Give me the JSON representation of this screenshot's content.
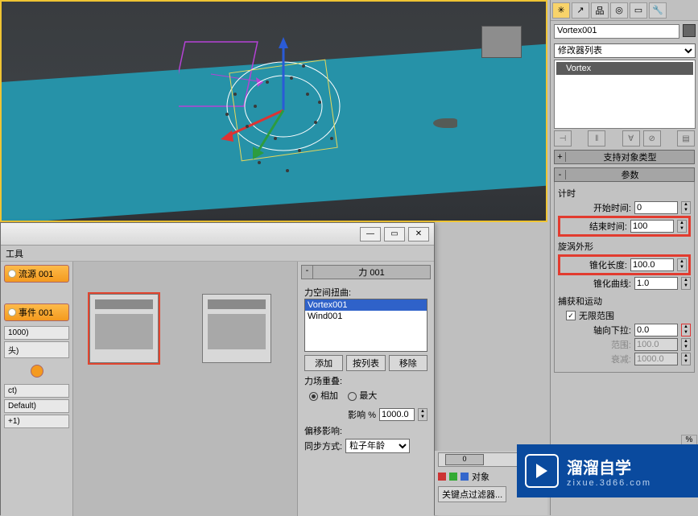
{
  "viewport": {},
  "cmdpanel": {
    "object_name": "Vortex001",
    "modifier_list_label": "修改器列表",
    "stack_item": "Vortex",
    "rollouts": {
      "support_types": {
        "pm": "+",
        "title": "支持对象类型"
      },
      "params": {
        "pm": "-",
        "title": "参数",
        "timing_label": "计时",
        "start_label": "开始时间:",
        "start_val": "0",
        "end_label": "结束时间:",
        "end_val": "100",
        "vortex_shape_label": "旋涡外形",
        "taper_len_label": "锥化长度:",
        "taper_len_val": "100.0",
        "taper_curve_label": "锥化曲线:",
        "taper_curve_val": "1.0",
        "capture_label": "捕获和运动",
        "unlimited_label": "无限范围",
        "axial_label": "轴向下拉:",
        "axial_val": "0.0",
        "range_label": "范围:",
        "range_val": "100.0",
        "falloff_label": "衰减:",
        "falloff_val": "1000.0"
      }
    }
  },
  "pview": {
    "menu_tools": "工具",
    "nodes": {
      "pf_source": "流源 001",
      "event": "事件 001",
      "lines": [
        "1000)",
        "头)",
        "ct)",
        "Default)",
        "+1)"
      ]
    },
    "force_panel": {
      "pm": "-",
      "title": "力 001",
      "spacewarps_label": "力空间扭曲:",
      "list": [
        "Vortex001",
        "Wind001"
      ],
      "btn_add": "添加",
      "btn_bylist": "按列表",
      "btn_remove": "移除",
      "overlap_label": "力场重叠:",
      "opt_add": "相加",
      "opt_max": "最大",
      "influence_label": "影响 %",
      "influence_val": "1000.0",
      "offset_label": "偏移影响:",
      "sync_label": "同步方式:",
      "sync_val": "粒子年龄"
    }
  },
  "timeline": {
    "pos_label": "0",
    "obj_label": "对象",
    "keyfilter_label": "关键点过滤器..."
  },
  "watermark": {
    "big": "溜溜自学",
    "small": "zixue.3d66.com"
  },
  "percent": "%"
}
